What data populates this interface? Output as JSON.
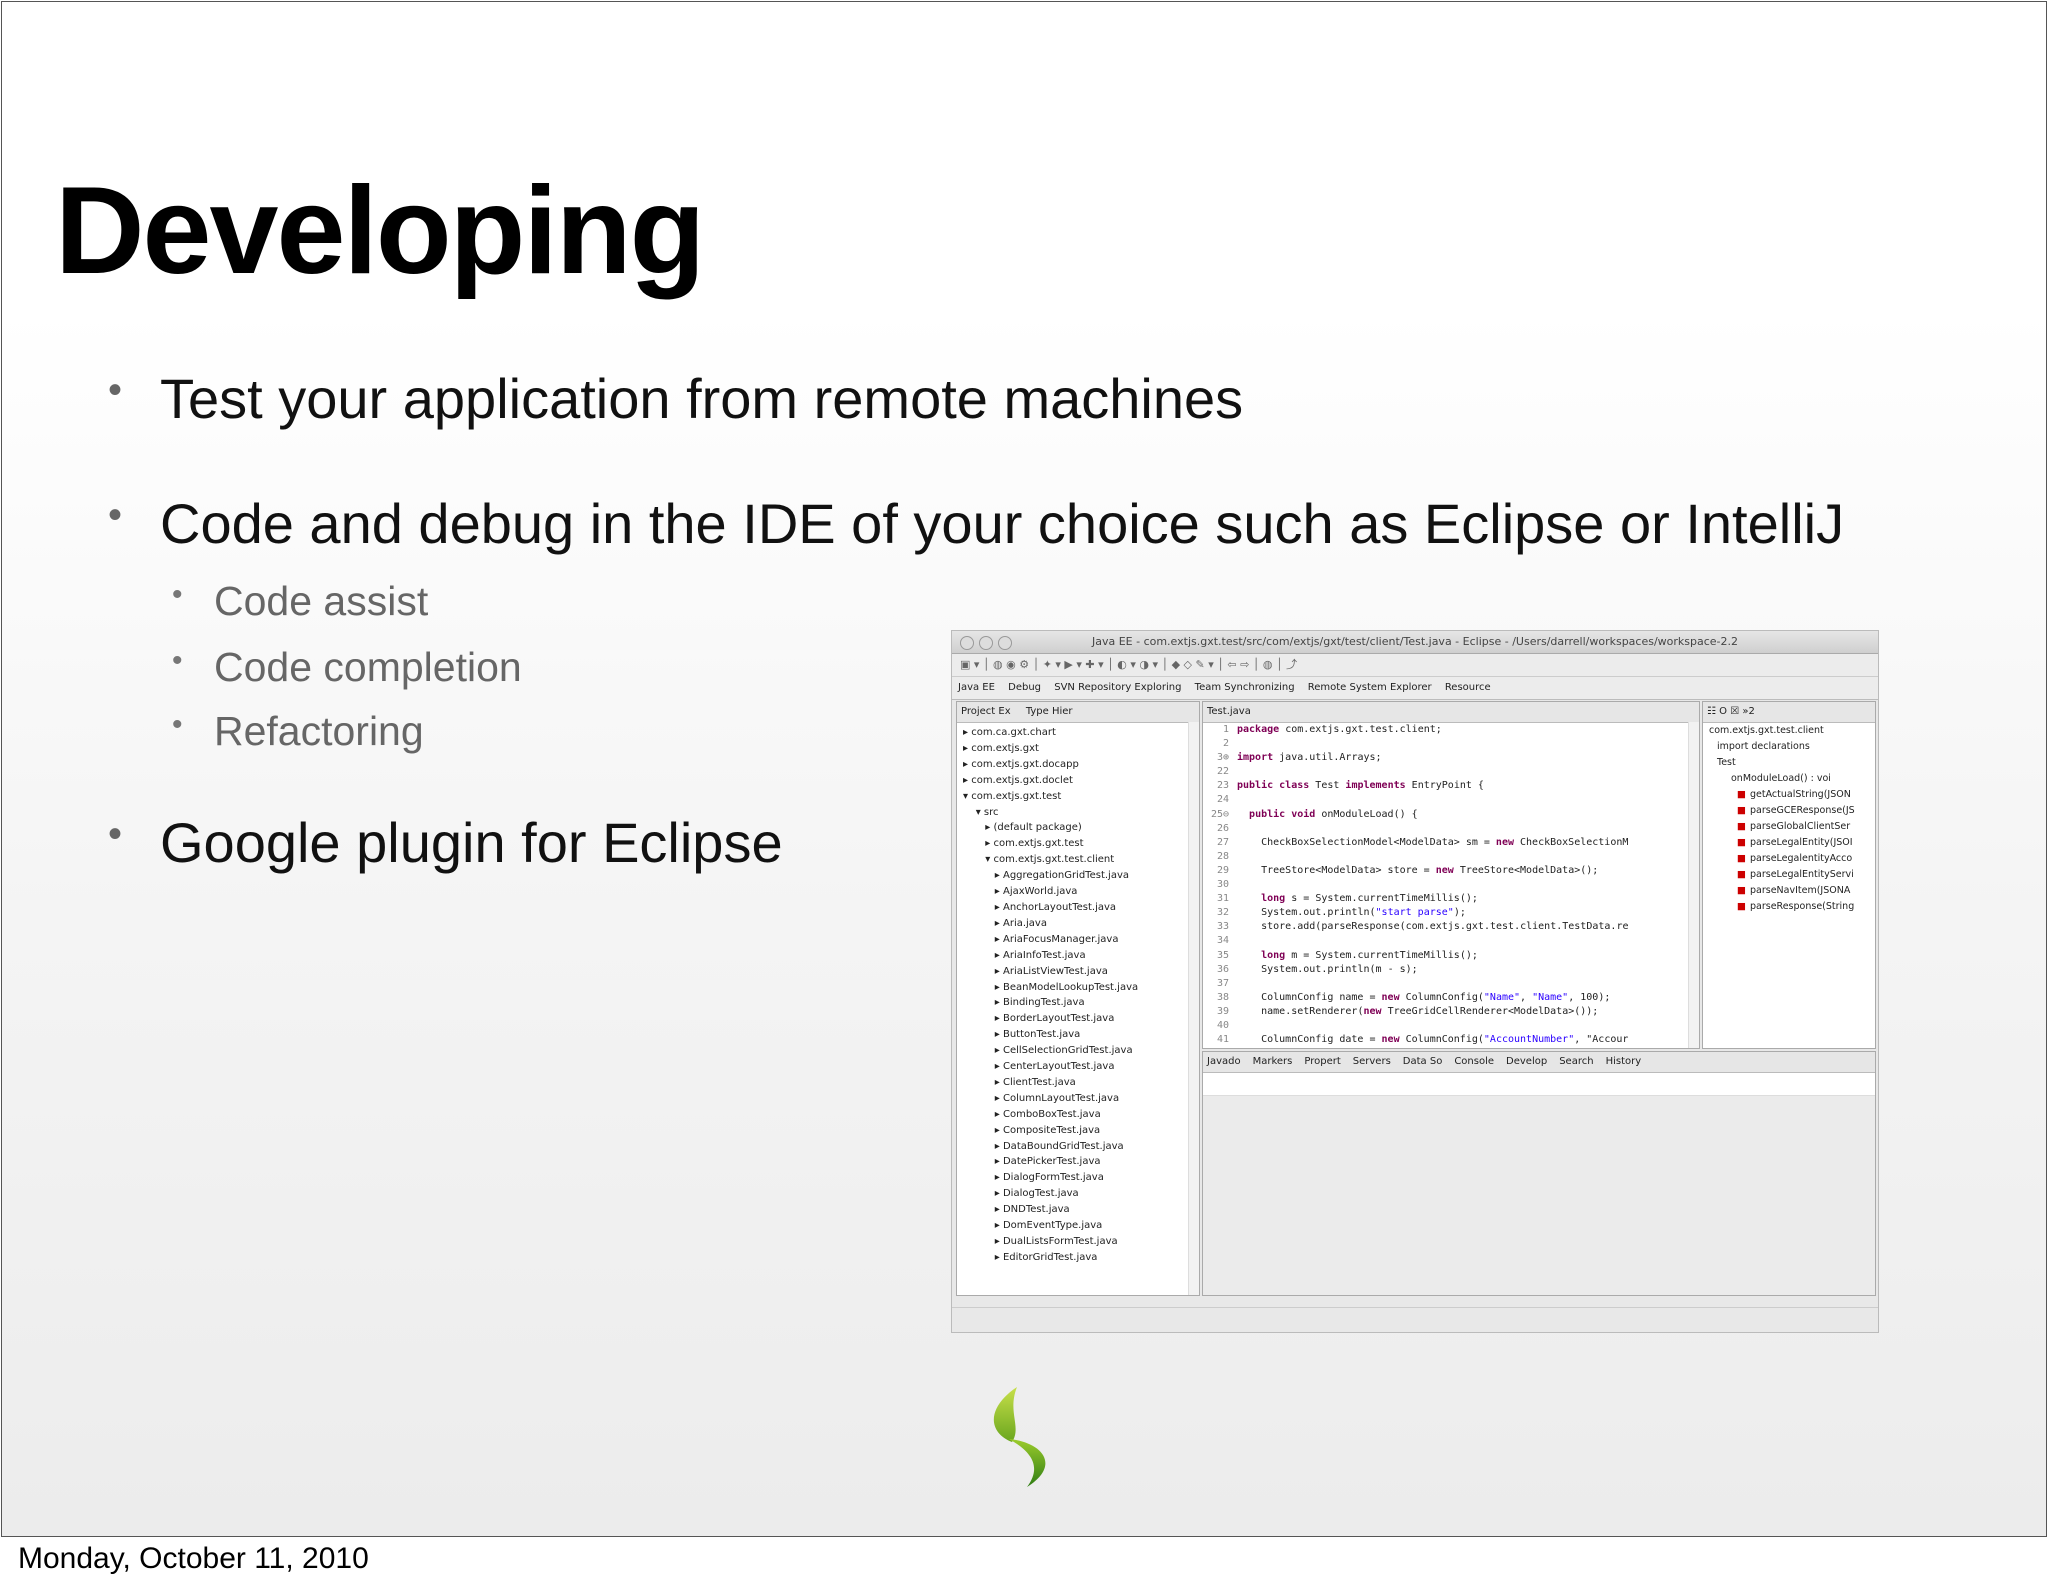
{
  "slide": {
    "title": "Developing",
    "bullets": [
      "Test your application from remote machines",
      "Code and debug in the IDE of your choice such as Eclipse or IntelliJ",
      "Google plugin for Eclipse"
    ],
    "sub_bullets": [
      "Code assist",
      "Code completion",
      "Refactoring"
    ],
    "footer": "Monday, October 11, 2010",
    "bullet_glyph": "•"
  },
  "ide": {
    "window_title": "Java EE - com.extjs.gxt.test/src/com/extjs/gxt/test/client/Test.java - Eclipse - /Users/darrell/workspaces/workspace-2.2",
    "perspectives": [
      "Java EE",
      "Debug",
      "SVN Repository Exploring",
      "Team Synchronizing",
      "Remote System Explorer",
      "Resource"
    ],
    "left_tabs": [
      "Project Ex",
      "Type Hier"
    ],
    "tree": [
      "▸ com.ca.gxt.chart",
      "▸ com.extjs.gxt",
      "▸ com.extjs.gxt.docapp",
      "▸ com.extjs.gxt.doclet",
      "▾ com.extjs.gxt.test",
      "    ▾ src",
      "       ▸ (default package)",
      "       ▸ com.extjs.gxt.test",
      "       ▾ com.extjs.gxt.test.client",
      "          ▸ AggregationGridTest.java",
      "          ▸ AjaxWorld.java",
      "          ▸ AnchorLayoutTest.java",
      "          ▸ Aria.java",
      "          ▸ AriaFocusManager.java",
      "          ▸ AriaInfoTest.java",
      "          ▸ AriaListViewTest.java",
      "          ▸ BeanModelLookupTest.java",
      "          ▸ BindingTest.java",
      "          ▸ BorderLayoutTest.java",
      "          ▸ ButtonTest.java",
      "          ▸ CellSelectionGridTest.java",
      "          ▸ CenterLayoutTest.java",
      "          ▸ ClientTest.java",
      "          ▸ ColumnLayoutTest.java",
      "          ▸ ComboBoxTest.java",
      "          ▸ CompositeTest.java",
      "          ▸ DataBoundGridTest.java",
      "          ▸ DatePickerTest.java",
      "          ▸ DialogFormTest.java",
      "          ▸ DialogTest.java",
      "          ▸ DNDTest.java",
      "          ▸ DomEventType.java",
      "          ▸ DualListsFormTest.java",
      "          ▸ EditorGridTest.java"
    ],
    "editor_tab": "Test.java",
    "code_lines": [
      {
        "n": "1",
        "t": "package com.extjs.gxt.test.client;"
      },
      {
        "n": "2",
        "t": ""
      },
      {
        "n": "3⊕",
        "t": "import java.util.Arrays;"
      },
      {
        "n": "22",
        "t": ""
      },
      {
        "n": "23",
        "t": "public class Test implements EntryPoint {"
      },
      {
        "n": "24",
        "t": ""
      },
      {
        "n": "25⊖",
        "t": "  public void onModuleLoad() {"
      },
      {
        "n": "26",
        "t": ""
      },
      {
        "n": "27",
        "t": "    CheckBoxSelectionModel<ModelData> sm = new CheckBoxSelectionM"
      },
      {
        "n": "28",
        "t": ""
      },
      {
        "n": "29",
        "t": "    TreeStore<ModelData> store = new TreeStore<ModelData>();"
      },
      {
        "n": "30",
        "t": ""
      },
      {
        "n": "31",
        "t": "    long s = System.currentTimeMillis();"
      },
      {
        "n": "32",
        "t": "    System.out.println(\"start parse\");"
      },
      {
        "n": "33",
        "t": "    store.add(parseResponse(com.extjs.gxt.test.client.TestData.re"
      },
      {
        "n": "34",
        "t": ""
      },
      {
        "n": "35",
        "t": "    long m = System.currentTimeMillis();"
      },
      {
        "n": "36",
        "t": "    System.out.println(m - s);"
      },
      {
        "n": "37",
        "t": ""
      },
      {
        "n": "38",
        "t": "    ColumnConfig name = new ColumnConfig(\"Name\", \"Name\", 100);"
      },
      {
        "n": "39",
        "t": "    name.setRenderer(new TreeGridCellRenderer<ModelData>());"
      },
      {
        "n": "40",
        "t": ""
      },
      {
        "n": "41",
        "t": "    ColumnConfig date = new ColumnConfig(\"AccountNumber\", \"Accour"
      }
    ],
    "outline": [
      "com.extjs.gxt.test.client",
      "import declarations",
      "Test",
      "onModuleLoad() : voi",
      "getActualString(JSON",
      "parseGCEResponse(JS",
      "parseGlobalClientSer",
      "parseLegalEntity(JSOI",
      "parseLegalentityAcco",
      "parseLegalEntityServi",
      "parseNavItem(JSONA",
      "parseResponse(String"
    ],
    "bottom_tabs": [
      "Javado",
      "Markers",
      "Propert",
      "Servers",
      "Data So",
      "Console",
      "Develop",
      "Search",
      "History"
    ]
  }
}
